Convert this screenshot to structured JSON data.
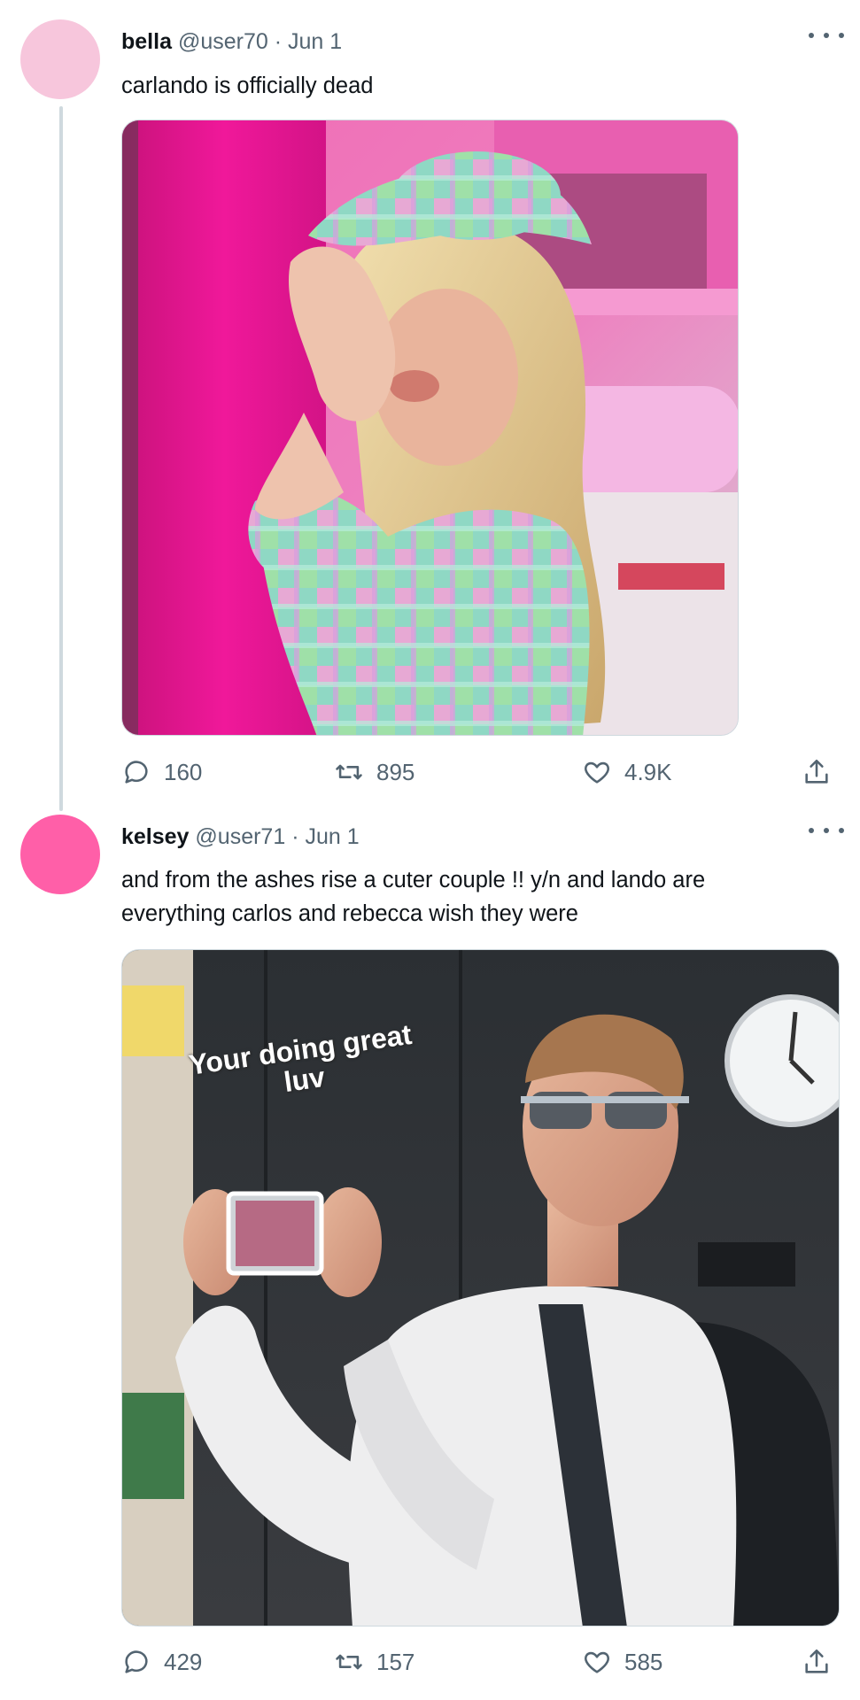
{
  "tweets": [
    {
      "name": "bella",
      "handle": "@user70",
      "separator": "·",
      "date": "Jun 1",
      "text": "carlando is officially dead",
      "avatar_color": "#f7c6dc",
      "media_description": "photo",
      "actions": {
        "replies": "160",
        "retweets": "895",
        "likes": "4.9K"
      }
    },
    {
      "name": "kelsey",
      "handle": "@user71",
      "separator": "·",
      "date": "Jun 1",
      "text": "and from the ashes rise a cuter couple !! y/n and lando are everything carlos and rebecca wish they were",
      "avatar_color": "#ff5fa8",
      "media_caption": "Your doing great luv",
      "actions": {
        "replies": "429",
        "retweets": "157",
        "likes": "585"
      }
    }
  ],
  "icons": [
    "reply-icon",
    "retweet-icon",
    "like-icon",
    "share-icon",
    "more-icon"
  ],
  "colors": {
    "text": "#0f1419",
    "secondary": "#536471",
    "thread_line": "#cfd9de"
  }
}
